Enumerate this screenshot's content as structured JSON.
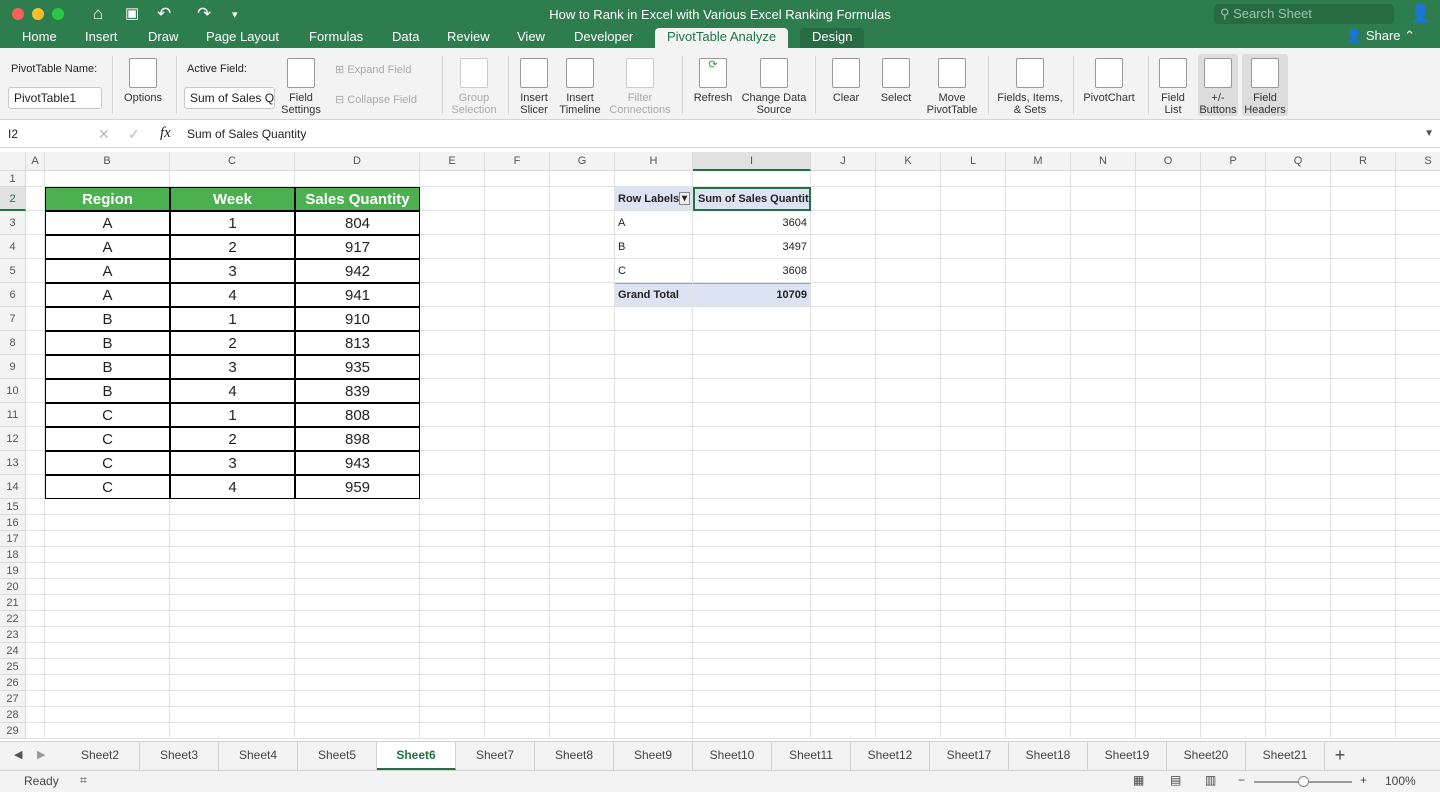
{
  "window": {
    "title": "How to Rank in Excel with Various Excel Ranking Formulas",
    "search_placeholder": "Search Sheet",
    "share": "Share"
  },
  "tabs": [
    "Home",
    "Insert",
    "Draw",
    "Page Layout",
    "Formulas",
    "Data",
    "Review",
    "View",
    "Developer",
    "PivotTable Analyze",
    "Design"
  ],
  "active_tab": "PivotTable Analyze",
  "ribbon": {
    "pivot_name_label": "PivotTable Name:",
    "pivot_name_value": "PivotTable1",
    "options": "Options",
    "active_field_label": "Active Field:",
    "active_field_value": "Sum of Sales Quantity",
    "field_settings": "Field Settings",
    "expand_field": "Expand Field",
    "collapse_field": "Collapse Field",
    "group_selection": "Group Selection",
    "insert_slicer": "Insert Slicer",
    "insert_timeline": "Insert Timeline",
    "filter_connections": "Filter Connections",
    "refresh": "Refresh",
    "change_data_source": "Change Data Source",
    "clear": "Clear",
    "select": "Select",
    "move_pivottable": "Move PivotTable",
    "fields_items_sets": "Fields, Items, & Sets",
    "pivotchart": "PivotChart",
    "field_list": "Field List",
    "buttons": "+/- Buttons",
    "field_headers": "Field Headers"
  },
  "formula_bar": {
    "name_box": "I2",
    "formula": "Sum of Sales Quantity"
  },
  "columns": [
    "A",
    "B",
    "C",
    "D",
    "E",
    "F",
    "G",
    "H",
    "I",
    "J",
    "K",
    "L",
    "M",
    "N",
    "O",
    "P",
    "Q",
    "R",
    "S"
  ],
  "selected_cell": {
    "col": "I",
    "row": 2
  },
  "data_table": {
    "headers": [
      "Region",
      "Week",
      "Sales Quantity"
    ],
    "rows": [
      [
        "A",
        "1",
        "804"
      ],
      [
        "A",
        "2",
        "917"
      ],
      [
        "A",
        "3",
        "942"
      ],
      [
        "A",
        "4",
        "941"
      ],
      [
        "B",
        "1",
        "910"
      ],
      [
        "B",
        "2",
        "813"
      ],
      [
        "B",
        "3",
        "935"
      ],
      [
        "B",
        "4",
        "839"
      ],
      [
        "C",
        "1",
        "808"
      ],
      [
        "C",
        "2",
        "898"
      ],
      [
        "C",
        "3",
        "943"
      ],
      [
        "C",
        "4",
        "959"
      ]
    ],
    "header_color": "#4caf50"
  },
  "pivot": {
    "headers": [
      "Row Labels",
      "Sum of Sales Quantity"
    ],
    "rows": [
      [
        "A",
        "3604"
      ],
      [
        "B",
        "3497"
      ],
      [
        "C",
        "3608"
      ]
    ],
    "total": [
      "Grand Total",
      "10709"
    ],
    "header_color": "#dce3f3"
  },
  "sheets": [
    "Sheet2",
    "Sheet3",
    "Sheet4",
    "Sheet5",
    "Sheet6",
    "Sheet7",
    "Sheet8",
    "Sheet9",
    "Sheet10",
    "Sheet11",
    "Sheet12",
    "Sheet17",
    "Sheet18",
    "Sheet19",
    "Sheet20",
    "Sheet21"
  ],
  "active_sheet": "Sheet6",
  "status": {
    "mode": "Ready",
    "zoom": "100%",
    "zoom_level": 100
  }
}
